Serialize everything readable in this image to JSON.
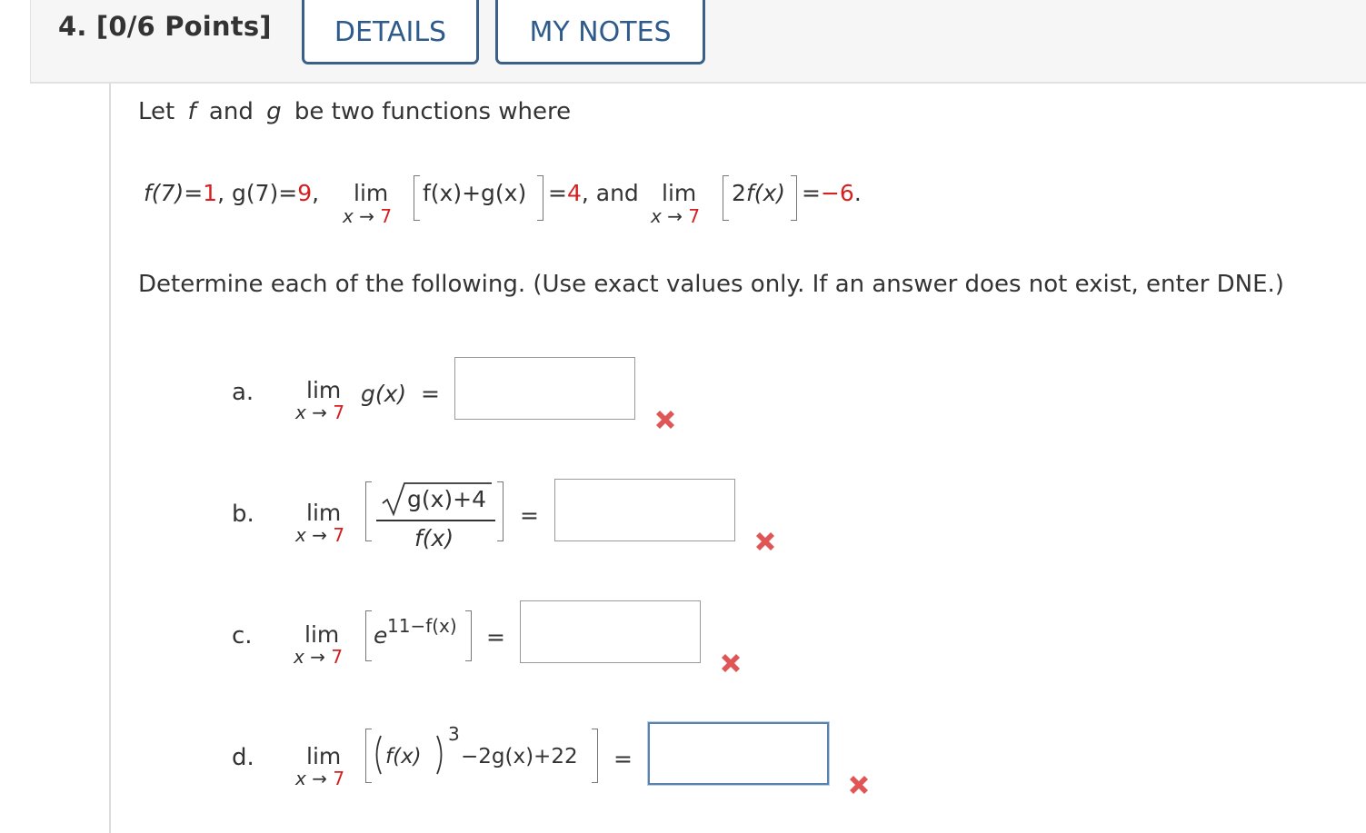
{
  "header": {
    "question_label": "4. [0/6 Points]",
    "details_button": "DETAILS",
    "notes_button": "MY NOTES"
  },
  "problem": {
    "intro_prefix": "Let",
    "f_var": "f",
    "and_word": "and",
    "g_var": "g",
    "intro_suffix": "be two functions where",
    "given": {
      "f7_lhs": "f(7)=",
      "f7_val": "1",
      "g7_lhs": ", g(7)=",
      "g7_val": "9",
      "g7_end": ",",
      "lim1_word": "lim",
      "lim1_sub_x": "x",
      "lim1_sub_arrow": "→",
      "lim1_sub_val": "7",
      "lim1_expr": "f(x)+g(x)",
      "lim1_eq": "=",
      "lim1_val": "4",
      "and_text": ", and",
      "lim2_word": "lim",
      "lim2_sub_x": "x",
      "lim2_sub_arrow": "→",
      "lim2_sub_val": "7",
      "lim2_expr_coef": "2",
      "lim2_expr_fn": "f(x)",
      "lim2_eq": "=",
      "lim2_val": "−6",
      "lim2_end": "."
    },
    "instructions": "Determine each of the following. (Use exact values only. If an answer does not exist, enter DNE.)"
  },
  "parts": {
    "a": {
      "label": "a.",
      "lim": "lim",
      "sub_x": "x",
      "sub_arrow": "→",
      "sub_val": "7",
      "expr": "g(x)",
      "eq": "=",
      "answer": ""
    },
    "b": {
      "label": "b.",
      "lim": "lim",
      "sub_x": "x",
      "sub_arrow": "→",
      "sub_val": "7",
      "numerator": "g(x)+4",
      "denominator": "f(x)",
      "eq": "=",
      "answer": ""
    },
    "c": {
      "label": "c.",
      "lim": "lim",
      "sub_x": "x",
      "sub_arrow": "→",
      "sub_val": "7",
      "base": "e",
      "exponent": "11−f(x)",
      "eq": "=",
      "answer": ""
    },
    "d": {
      "label": "d.",
      "lim": "lim",
      "sub_x": "x",
      "sub_arrow": "→",
      "sub_val": "7",
      "inner": "f(x)",
      "power": "3",
      "rest": "−2g(x)+22",
      "eq": "=",
      "answer": ""
    }
  },
  "icons": {
    "incorrect": "x-mark-icon",
    "incorrect_color": "#e05555"
  },
  "colors": {
    "accent": "#2f5b8c",
    "given_values": "#d42020"
  }
}
